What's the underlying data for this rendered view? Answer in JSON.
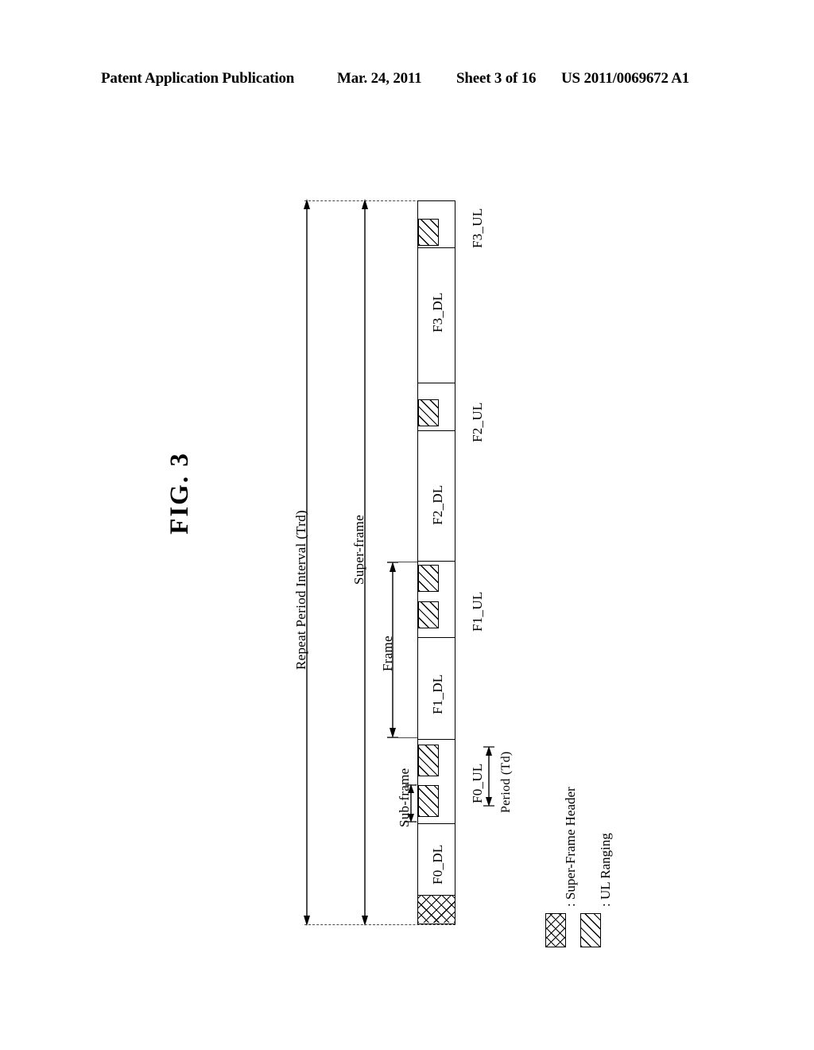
{
  "header": {
    "publication": "Patent Application Publication",
    "date": "Mar. 24, 2011",
    "sheet": "Sheet 3 of 16",
    "number": "US 2011/0069672 A1"
  },
  "figure": {
    "title": "FIG. 3",
    "caption_orientation": "rotated-90-ccw"
  },
  "measures": {
    "repeat_period": "Repeat Period Interval (Trd)",
    "superframe": "Super-frame",
    "frame": "Frame",
    "subframe": "Sub-frame",
    "period": "Period (Td)"
  },
  "bar": {
    "description": "Super-frame structure composed of four frames F0..F3, each with a DL zone and a UL zone containing UL Ranging blocks, preceded by a Super-Frame Header.",
    "segments": [
      {
        "id": "f3_ul",
        "label": "F3_UL",
        "kind": "ul",
        "ranging_blocks": 1
      },
      {
        "id": "f3_dl",
        "label": "F3_DL",
        "kind": "dl",
        "ranging_blocks": 0
      },
      {
        "id": "f2_ul",
        "label": "F2_UL",
        "kind": "ul",
        "ranging_blocks": 1
      },
      {
        "id": "f2_dl",
        "label": "F2_DL",
        "kind": "dl",
        "ranging_blocks": 0
      },
      {
        "id": "f1_ul",
        "label": "F1_UL",
        "kind": "ul",
        "ranging_blocks": 2
      },
      {
        "id": "f1_dl",
        "label": "F1_DL",
        "kind": "dl",
        "ranging_blocks": 0
      },
      {
        "id": "f0_ul",
        "label": "F0_UL",
        "kind": "ul",
        "ranging_blocks": 2
      },
      {
        "id": "f0_dl",
        "label": "F0_DL",
        "kind": "dl",
        "ranging_blocks": 0
      },
      {
        "id": "sfh",
        "label": "",
        "kind": "super-frame-header",
        "ranging_blocks": 0
      }
    ]
  },
  "legend": {
    "items": [
      {
        "swatch": "cross-hatch",
        "text": ": Super-Frame Header"
      },
      {
        "swatch": "diagonal-hatch",
        "text": ": UL Ranging"
      }
    ]
  }
}
